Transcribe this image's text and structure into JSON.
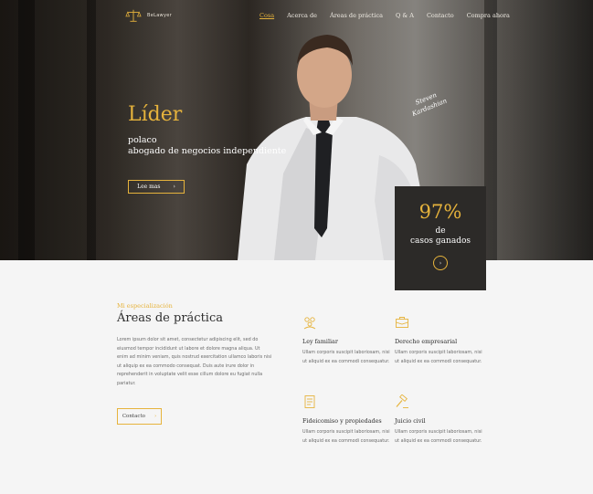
{
  "logo": {
    "text": "BeLawyer"
  },
  "nav": {
    "items": [
      "Cosa",
      "Acerca de",
      "Áreas de práctica",
      "Q & A",
      "Contacto",
      "Compra ahora"
    ]
  },
  "hero": {
    "headline": "Líder",
    "sub_line1": "polaco",
    "sub_line2": "abogado de negocios independiente",
    "button_label": "Lee mas",
    "signature_line1": "Steven",
    "signature_line2": "Kardashian"
  },
  "stat": {
    "value": "97%",
    "line1": "de",
    "line2": "casos ganados"
  },
  "practice": {
    "label": "Mi especialización",
    "title": "Áreas de práctica",
    "body": "Lorem ipsum dolor sit amet, consectetur adipiscing elit, sed do eiusmod tempor incididunt ut labore et dolore magna aliqua. Ut enim ad minim veniam, quis nostrud exercitation ullamco laboris nisi ut aliquip ex ea commodo consequat. Duis aute irure dolor in reprehenderit in voluptate velit esse cillum dolore eu fugiat nulla pariatur.",
    "button_label": "Contacto",
    "cards": [
      {
        "title": "Ley familiar",
        "body": "Ullam corporis suscipit laboriosam, nisi ut aliquid ex ea commodi consequatur.",
        "icon": "family-icon"
      },
      {
        "title": "Derecho empresarial",
        "body": "Ullam corporis suscipit laboriosam, nisi ut aliquid ex ea commodi consequatur.",
        "icon": "briefcase-icon"
      },
      {
        "title": "Fideicomiso y propiedades",
        "body": "Ullam corporis suscipit laboriosam, nisi ut aliquid ex ea commodi consequatur.",
        "icon": "document-icon"
      },
      {
        "title": "Juicio civil",
        "body": "Ullam corporis suscipit laboriosam, nisi ut aliquid ex ea commodi consequatur.",
        "icon": "gavel-icon"
      }
    ]
  },
  "colors": {
    "accent": "#e6b33c",
    "dark_box": "#2c2a28",
    "background": "#f5f5f5"
  }
}
